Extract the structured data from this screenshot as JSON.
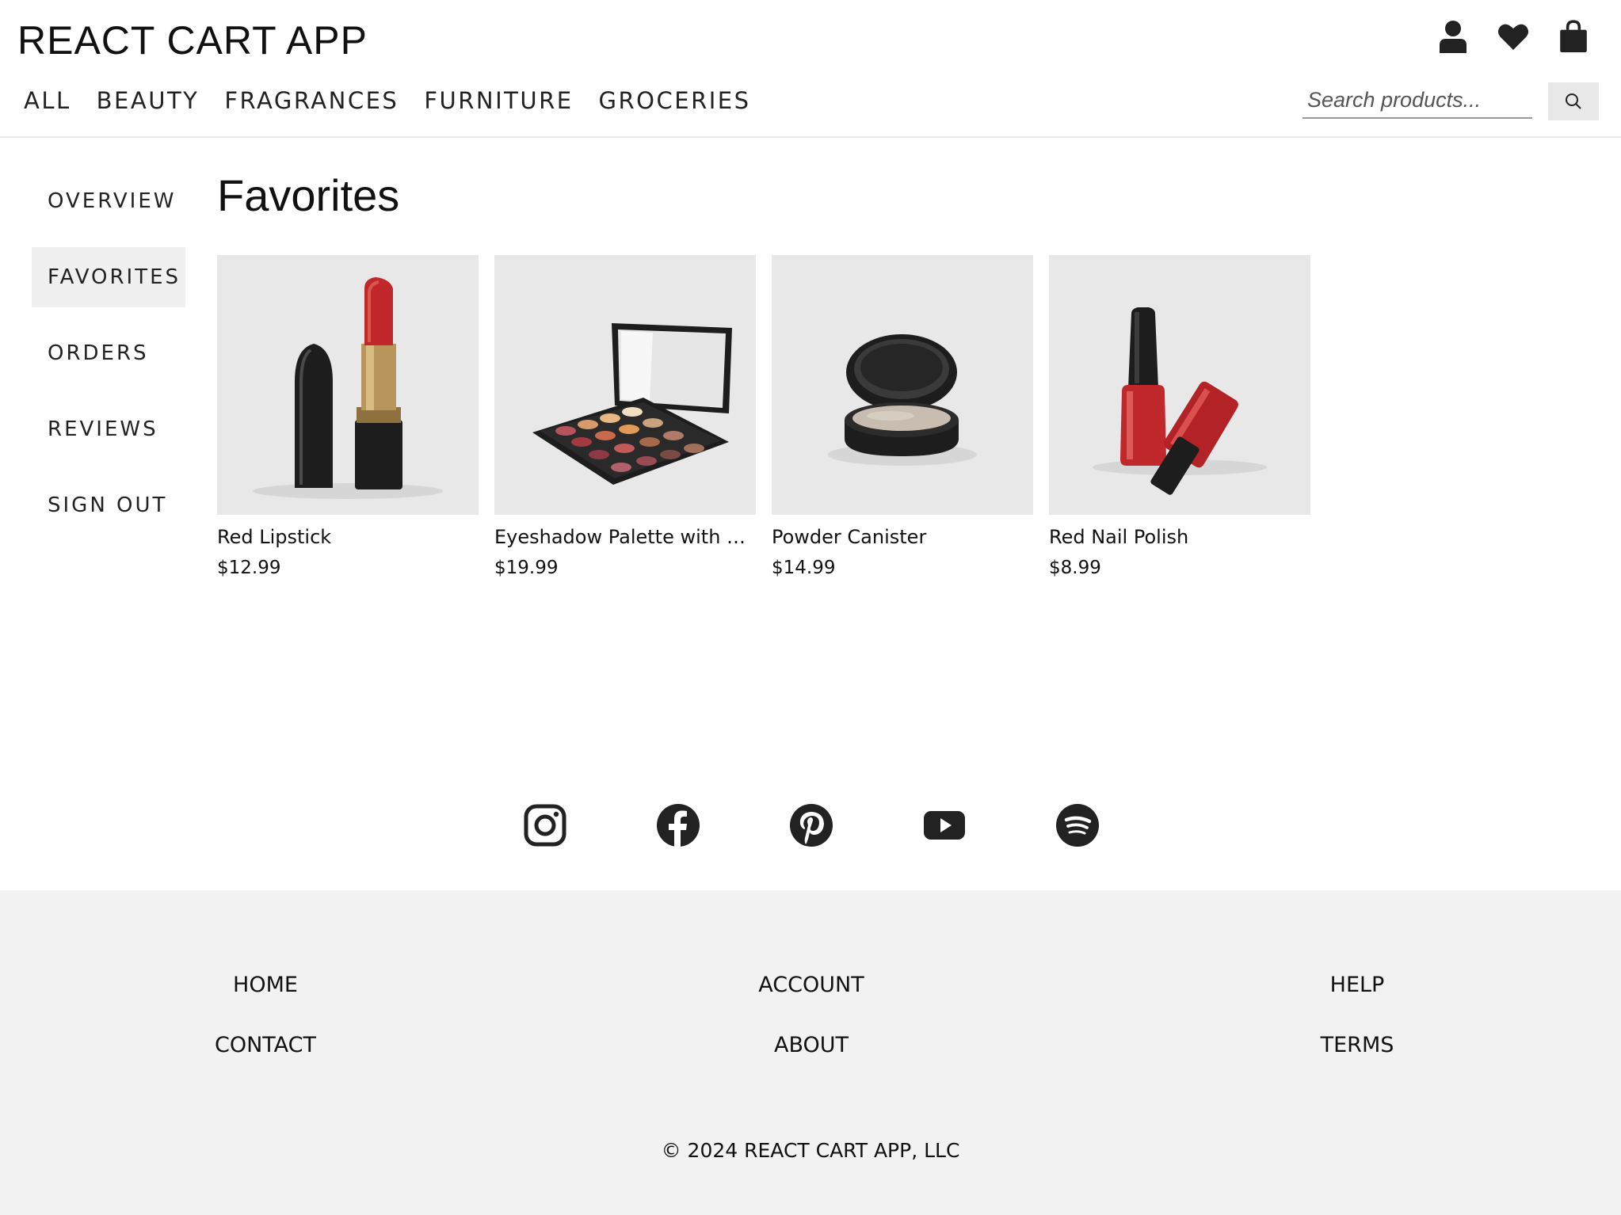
{
  "header": {
    "brand": "REACT CART APP",
    "icons": [
      "user-icon",
      "heart-icon",
      "shopping-bag-icon"
    ],
    "categories": [
      "ALL",
      "BEAUTY",
      "FRAGRANCES",
      "FURNITURE",
      "GROCERIES"
    ],
    "search": {
      "placeholder": "Search products...",
      "value": ""
    }
  },
  "sidebar": {
    "items": [
      "OVERVIEW",
      "FAVORITES",
      "ORDERS",
      "REVIEWS",
      "SIGN OUT"
    ],
    "active": "FAVORITES"
  },
  "main": {
    "title": "Favorites",
    "products": [
      {
        "name": "Red Lipstick",
        "price": "$12.99",
        "image": "lipstick"
      },
      {
        "name": "Eyeshadow Palette with Mirror",
        "price": "$19.99",
        "image": "eyeshadow-palette"
      },
      {
        "name": "Powder Canister",
        "price": "$14.99",
        "image": "powder-canister"
      },
      {
        "name": "Red Nail Polish",
        "price": "$8.99",
        "image": "nail-polish"
      }
    ]
  },
  "social": [
    "instagram-icon",
    "facebook-icon",
    "pinterest-icon",
    "youtube-icon",
    "spotify-icon"
  ],
  "footer": {
    "links": {
      "home": "HOME",
      "account": "ACCOUNT",
      "help": "HELP",
      "contact": "CONTACT",
      "about": "ABOUT",
      "terms": "TERMS"
    },
    "copyright": "© 2024 REACT CART APP, LLC"
  },
  "colors": {
    "accent_bg": "#f0f0f0",
    "footer_bg": "#f2f2f2",
    "icon": "#222222",
    "product_red": "#c0282b"
  }
}
